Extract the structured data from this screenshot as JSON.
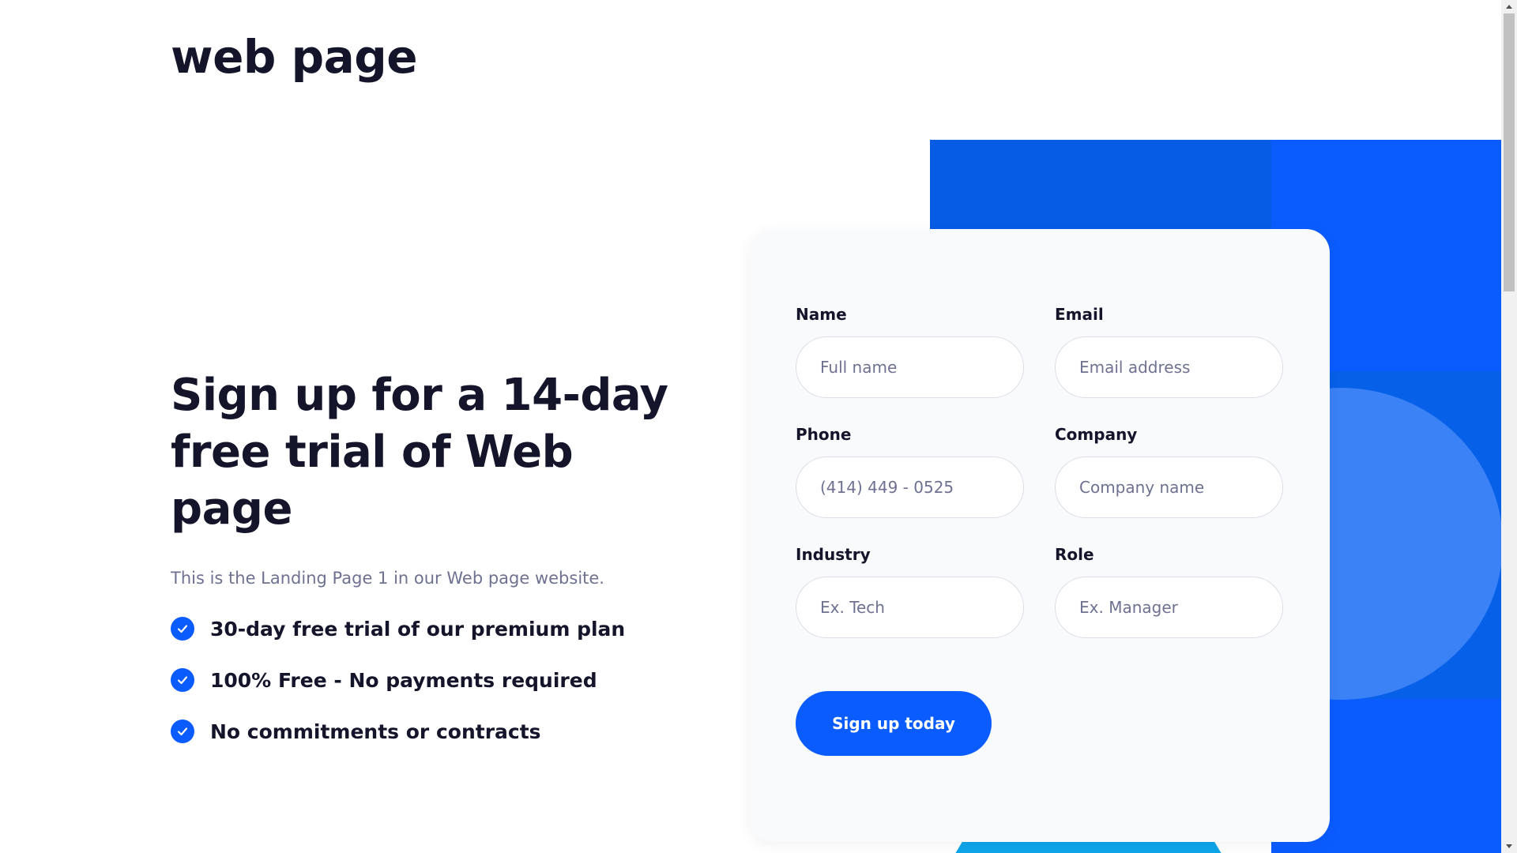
{
  "header": {
    "logo": "web page"
  },
  "hero": {
    "headline": "Sign up for a 14-day free trial of Web page",
    "subtext": "This is the Landing Page 1 in our Web page website.",
    "features": [
      "30-day free trial of our premium plan",
      "100% Free - No payments required",
      "No commitments or contracts"
    ]
  },
  "form": {
    "name": {
      "label": "Name",
      "placeholder": "Full name"
    },
    "email": {
      "label": "Email",
      "placeholder": "Email address"
    },
    "phone": {
      "label": "Phone",
      "placeholder": "(414) 449 - 0525"
    },
    "company": {
      "label": "Company",
      "placeholder": "Company name"
    },
    "industry": {
      "label": "Industry",
      "placeholder": "Ex. Tech"
    },
    "role": {
      "label": "Role",
      "placeholder": "Ex. Manager"
    },
    "submit_label": "Sign up today"
  },
  "icons": {
    "feature_check": "check-circle-icon",
    "scroll_up": "chevron-up-icon",
    "scroll_down": "chevron-down-icon"
  },
  "colors": {
    "primary": "#0b5cff",
    "heading": "#14142b",
    "muted": "#6e7191",
    "card_bg": "#f9fafc",
    "accent_light_blue": "#3b82f6",
    "accent_cyan": "#0ea5e9"
  }
}
